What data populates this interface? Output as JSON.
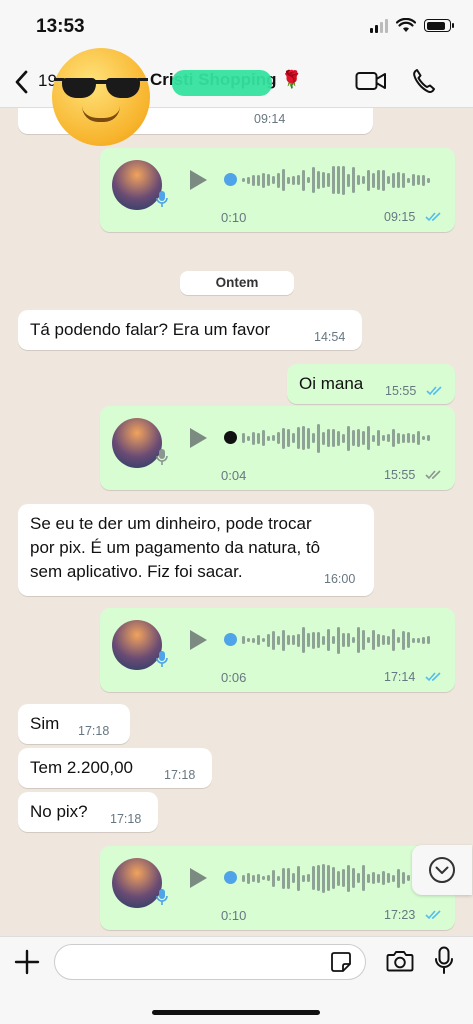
{
  "status_bar": {
    "time": "13:53",
    "battery_level": 0.85
  },
  "header": {
    "back_count": "19",
    "contact_name": "Cristi Shopping 🌹",
    "icons": [
      "back-chevron-icon",
      "video-call-icon",
      "phone-call-icon"
    ]
  },
  "messages": [
    {
      "type": "text",
      "direction": "in",
      "time": "09:14"
    },
    {
      "type": "voice",
      "direction": "out",
      "duration": "0:10",
      "time": "09:15",
      "status": "read",
      "played": false
    },
    {
      "type": "date",
      "label": "Ontem"
    },
    {
      "type": "text",
      "direction": "in",
      "text": "Tá podendo falar? Era um favor",
      "time": "14:54"
    },
    {
      "type": "text",
      "direction": "out",
      "text": "Oi mana",
      "time": "15:55",
      "status": "read"
    },
    {
      "type": "voice",
      "direction": "out",
      "duration": "0:04",
      "time": "15:55",
      "status": "delivered",
      "played": true
    },
    {
      "type": "text",
      "direction": "in",
      "lines": [
        "Se eu te der um dinheiro, pode trocar",
        "por pix. É um pagamento da natura, tô",
        "sem aplicativo. Fiz foi sacar."
      ],
      "time": "16:00"
    },
    {
      "type": "voice",
      "direction": "out",
      "duration": "0:06",
      "time": "17:14",
      "status": "read",
      "played": false
    },
    {
      "type": "text",
      "direction": "in",
      "text": "Sim",
      "time": "17:18"
    },
    {
      "type": "text",
      "direction": "in",
      "text": "Tem 2.200,00",
      "time": "17:18"
    },
    {
      "type": "text",
      "direction": "in",
      "text": "No pix?",
      "time": "17:18"
    },
    {
      "type": "voice",
      "direction": "out",
      "duration": "0:10",
      "time": "17:23",
      "status": "read",
      "played": false
    }
  ],
  "input": {
    "value": "",
    "placeholder": ""
  },
  "colors": {
    "outgoing_bubble": "#d9fdd3",
    "incoming_bubble": "#ffffff",
    "read_ticks": "#53bdeb",
    "unplayed_dot": "#4fa3e8",
    "chat_background": "#efe7dd"
  }
}
